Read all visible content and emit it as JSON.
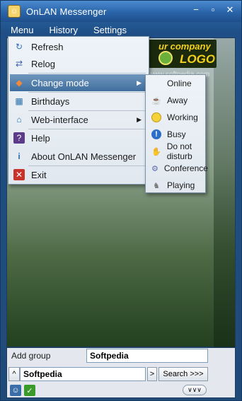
{
  "window": {
    "title": "OnLAN Messenger"
  },
  "menubar": [
    "Menu",
    "History",
    "Settings"
  ],
  "logo": {
    "line1": "ur company",
    "line2": "LOGO",
    "watermark": "www.softpedia.com"
  },
  "menu": {
    "items": [
      {
        "label": "Refresh",
        "icon": "refresh-icon",
        "glyph": "↻",
        "color": "#2f6fc0"
      },
      {
        "label": "Relog",
        "icon": "relog-icon",
        "glyph": "⇄",
        "color": "#3a5fa8"
      },
      {
        "label": "Change mode",
        "icon": "change-mode-icon",
        "glyph": "◆",
        "color": "#c8552a"
      },
      {
        "label": "Birthdays",
        "icon": "calendar-icon",
        "glyph": "▦",
        "color": "#2a6ea8"
      },
      {
        "label": "Web-interface",
        "icon": "web-icon",
        "glyph": "⌂",
        "color": "#2a6ea8"
      },
      {
        "label": "Help",
        "icon": "help-icon",
        "glyph": "?",
        "color": "#5b3b8a"
      },
      {
        "label": "About OnLAN Messenger",
        "icon": "info-icon",
        "glyph": "i",
        "color": "#2a6ea8"
      },
      {
        "label": "Exit",
        "icon": "exit-icon",
        "glyph": "✕",
        "color": "#c8322a"
      }
    ]
  },
  "submenu": {
    "items": [
      {
        "label": "Online",
        "icon": "online-icon",
        "glyph": "",
        "color": "#3a9a2a"
      },
      {
        "label": "Away",
        "icon": "coffee-icon",
        "glyph": "☕",
        "color": "#7a5a3a"
      },
      {
        "label": "Working",
        "icon": "lightbulb-icon",
        "glyph": "●",
        "color": "#e8c21a"
      },
      {
        "label": "Busy",
        "icon": "busy-icon",
        "glyph": "!",
        "color": "#2a6ec8"
      },
      {
        "label": "Do not disturb",
        "icon": "dnd-icon",
        "glyph": "✋",
        "color": "#e07a1a"
      },
      {
        "label": "Conference",
        "icon": "conference-icon",
        "glyph": "⚙",
        "color": "#5a6ab0"
      },
      {
        "label": "Playing",
        "icon": "joystick-icon",
        "glyph": "♞",
        "color": "#7a7a7a"
      }
    ]
  },
  "bottom": {
    "add_group_label": "Add group",
    "add_group_value": "Softpedia",
    "search_value": "Softpedia",
    "search_button": "Search >>>",
    "expand_glyph": "^",
    "go_glyph": ">",
    "collapse_glyph": "∨∨∨"
  }
}
